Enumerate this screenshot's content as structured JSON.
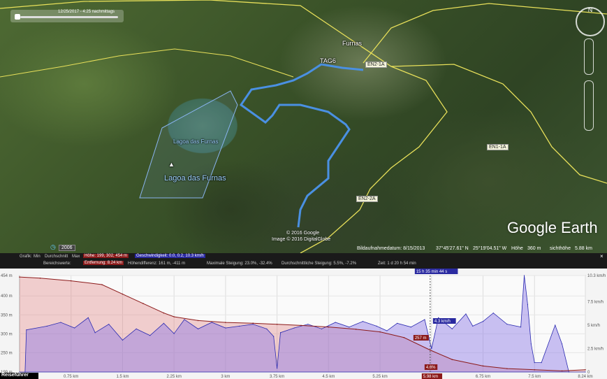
{
  "map": {
    "timebar_date": "12/25/2017 - 4:25 nachmittags",
    "place_labels": {
      "furnas": "Furnas",
      "tag6": "TAG6",
      "lake_small": "Lagoa das Furnas",
      "lake_large": "Lagoa das Furnas"
    },
    "road_labels": [
      "EN2-1A",
      "EN1-1A",
      "EN2-2A"
    ],
    "brand": "Google Earth",
    "copyright": [
      "© 2016 Google",
      "Image © 2016 DigitalGlobe"
    ],
    "status": {
      "date": "Bildaufnahmedatum: 8/15/2013",
      "lat": "37°45'27.61\" N",
      "lon": "25°19'04.51\" W",
      "height_label": "Höhe",
      "height": "360 m",
      "eye_label": "sichthöhe",
      "eye": "5.88 km"
    },
    "history_year": "2006"
  },
  "profile": {
    "close_icon": "×",
    "stats": {
      "graph_label": "Grafik:",
      "min_label": "Min",
      "avg_label": "Durchschnitt",
      "max_label": "Max",
      "height_val": "Höhe: 199, 302, 454 m",
      "speed_val": "Geschwindigkeit: 0.0, 0.2, 10.3 km/h",
      "range_label": "Bereichswerte:",
      "distance": "Entfernung: 8.24 km",
      "diff": "Höhendifferenz: 161 m, -411 m",
      "max_slope": "Maximale Steigung: 23.0%, -32.4%",
      "avg_slope": "Durchschnittliche Steigung: 5.5%, -7.2%",
      "time": "Zeit: 1 d 20 h 54 min"
    },
    "cursor_time": "15 h 35 min 44 s",
    "cursor_speed": "4.3 km/h",
    "cursor_elev": "257 m",
    "cursor_slope": "4.6%",
    "cursor_dist": "5.98 km",
    "guide_label": "Reiseführer"
  },
  "chart_data": {
    "type": "area",
    "xlabel": "",
    "ylabel": "",
    "x_ticks": [
      "0.75 km",
      "1.5 km",
      "2.25 km",
      "3 km",
      "3.75 km",
      "4.5 km",
      "5.25 km",
      "6 km",
      "6.75 km",
      "7.5 km",
      "8.24 km"
    ],
    "y_left_ticks": [
      "454 m",
      "400 m",
      "350 m",
      "300 m",
      "250 m",
      "199 m"
    ],
    "y_right_ticks": [
      "10.3 km/h",
      "7.5 km/h",
      "5 km/h",
      "2.5 km/h",
      "0"
    ],
    "ylim_left": [
      199,
      454
    ],
    "ylim_right": [
      0,
      10.3
    ],
    "xlim": [
      0,
      8.24
    ],
    "series": [
      {
        "name": "Höhe",
        "color": "#8b1a1a",
        "x": [
          0,
          0.3,
          0.75,
          1.2,
          1.5,
          1.8,
          2.1,
          2.25,
          2.6,
          3.0,
          3.4,
          3.75,
          4.1,
          4.5,
          4.9,
          5.25,
          5.6,
          5.98,
          6.3,
          6.75,
          7.1,
          7.5,
          7.9,
          8.24
        ],
        "y": [
          450,
          447,
          440,
          430,
          405,
          380,
          355,
          345,
          335,
          330,
          328,
          325,
          322,
          318,
          312,
          305,
          290,
          257,
          232,
          215,
          208,
          205,
          202,
          205
        ]
      },
      {
        "name": "Geschwindigkeit",
        "color": "#2a2ab0",
        "x": [
          0,
          0.08,
          0.1,
          0.4,
          0.6,
          0.8,
          1.0,
          1.1,
          1.3,
          1.5,
          1.7,
          1.9,
          2.1,
          2.25,
          2.4,
          2.6,
          2.8,
          3.0,
          3.2,
          3.4,
          3.6,
          3.7,
          3.75,
          3.8,
          4.0,
          4.2,
          4.4,
          4.6,
          4.8,
          5.0,
          5.2,
          5.35,
          5.5,
          5.7,
          5.9,
          6.0,
          6.1,
          6.3,
          6.5,
          6.6,
          6.75,
          6.9,
          7.1,
          7.3,
          7.35,
          7.4,
          7.45,
          7.5,
          7.6,
          7.8,
          7.9,
          8.0,
          8.24
        ],
        "y": [
          0,
          0,
          4.5,
          4.9,
          5.3,
          4.7,
          5.8,
          4.2,
          5.1,
          3.4,
          4.6,
          3.9,
          5.2,
          4.1,
          5.6,
          4.6,
          5.3,
          4.7,
          4.9,
          5.1,
          4.6,
          3.8,
          0.4,
          4.2,
          4.7,
          5.1,
          4.6,
          5.3,
          4.8,
          5.4,
          4.9,
          4.4,
          5.2,
          4.8,
          5.6,
          2.5,
          5.8,
          4.6,
          6.2,
          4.9,
          5.4,
          6.3,
          5.1,
          4.8,
          10.3,
          7.2,
          3.0,
          1.0,
          1.0,
          5.0,
          3.0,
          0,
          0
        ]
      }
    ],
    "cursor_x": 5.98
  }
}
